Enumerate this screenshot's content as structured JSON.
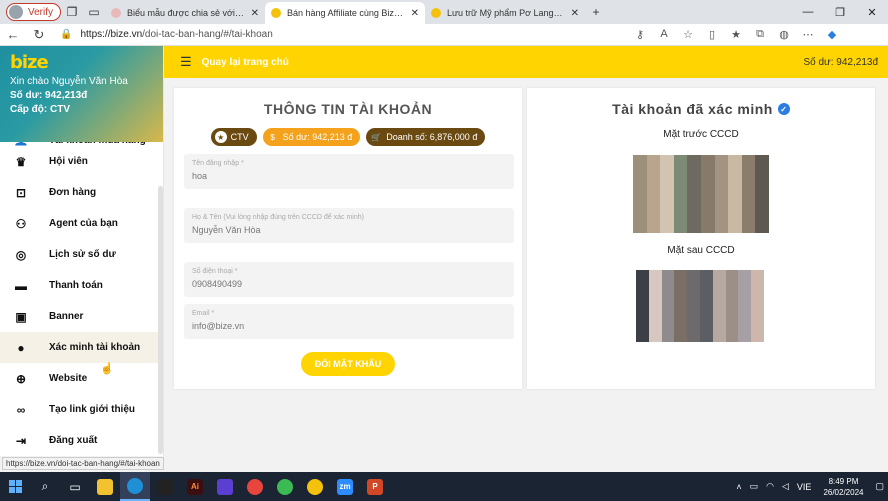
{
  "browser": {
    "profile": "Verify",
    "tabs": [
      {
        "title": "Biểu mẫu được chia sẻ với bạn: T",
        "favicon_color": "#e8b9b9"
      },
      {
        "title": "Bán hàng Affiliate cùng Biz-E kho",
        "favicon_color": "#f4c20d"
      },
      {
        "title": "Lưu trữ Mỹ phẩm Pơ Lang - Biz-E",
        "favicon_color": "#f4c20d"
      }
    ],
    "url_host": "https://bize.vn",
    "url_path": "/doi-tac-ban-hang/#/tai-khoan"
  },
  "sidebar": {
    "logo": "bize",
    "greeting": "Xin chào Nguyễn Văn Hòa",
    "balance_line": "Số dư: 942,213đ",
    "level_line": "Cấp độ: CTV",
    "items": [
      {
        "label": "Tài khoản mua hàng",
        "icon": "user-icon"
      },
      {
        "label": "Hội viên",
        "icon": "crown-icon"
      },
      {
        "label": "Đơn hàng",
        "icon": "box-icon"
      },
      {
        "label": "Agent của bạn",
        "icon": "group-icon"
      },
      {
        "label": "Lịch sử số dư",
        "icon": "fingerprint-icon"
      },
      {
        "label": "Thanh toán",
        "icon": "card-icon"
      },
      {
        "label": "Banner",
        "icon": "image-icon"
      },
      {
        "label": "Xác minh tài khoản",
        "icon": "person-icon"
      },
      {
        "label": "Website",
        "icon": "web-icon"
      },
      {
        "label": "Tạo link giới thiệu",
        "icon": "link-icon"
      },
      {
        "label": "Đăng xuất",
        "icon": "logout-icon"
      }
    ]
  },
  "topbar": {
    "back_label": "Quay lại trang chủ",
    "balance": "Số dư: 942,213đ"
  },
  "account": {
    "title": "THÔNG TIN TÀI KHOẢN",
    "chips": {
      "level": "CTV",
      "balance": "Số dư: 942,213 đ",
      "sales": "Doanh số: 6,876,000 đ"
    },
    "fields": [
      {
        "label": "Tên đăng nhập *",
        "value": "hoa"
      },
      {
        "label": "Họ & Tên (Vui lòng nhập đúng trên CCCD để xác minh)",
        "value": "Nguyễn Văn Hòa"
      },
      {
        "label": "Số điện thoại *",
        "value": "0908490499"
      },
      {
        "label": "Email *",
        "value": "info@bize.vn"
      }
    ],
    "change_password": "ĐỔI MẬT KHẨU"
  },
  "verified": {
    "title": "Tài khoản đã xác minh",
    "front_label": "Mặt trước CCCD",
    "back_label": "Mặt sau CCCD"
  },
  "status_url": "https://bize.vn/doi-tac-ban-hang/#/tai-khoan",
  "taskbar": {
    "lang": "VIE",
    "time": "8:49 PM",
    "date": "26/02/2024"
  },
  "colors": {
    "accent": "#ffd400",
    "chip_dark": "#6b4a12",
    "chip_orange": "#f4a21b"
  }
}
